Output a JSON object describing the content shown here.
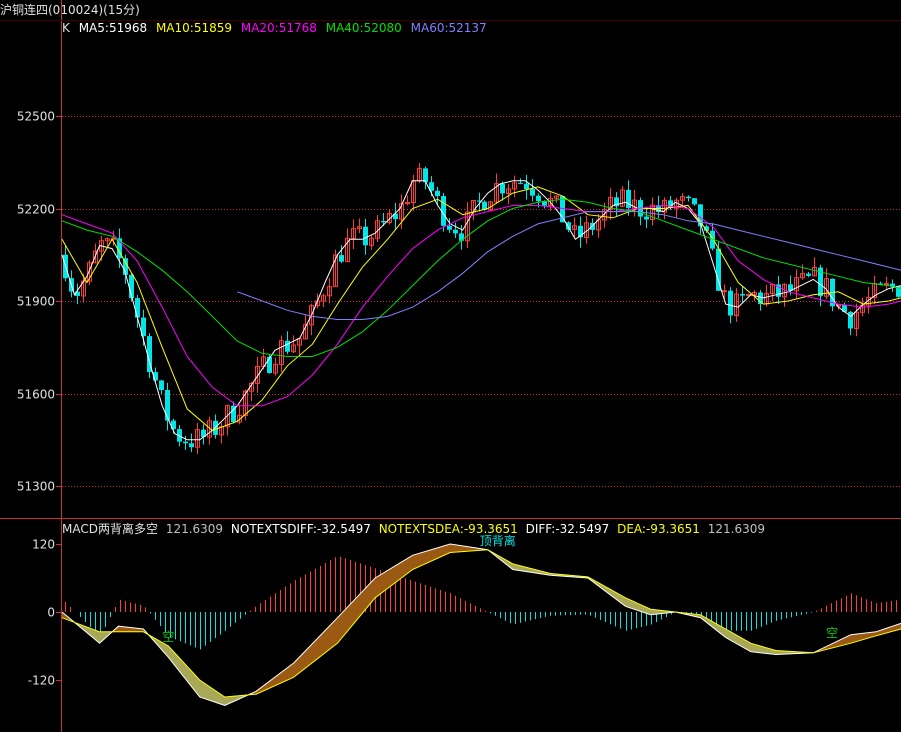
{
  "window": {
    "title": "沪铜连四(010024)(15分)"
  },
  "colors": {
    "up": "#ff3c3c",
    "down": "#00e5e5",
    "grid": "#c83232",
    "ma5": "#ffffff",
    "ma10": "#ffff00",
    "ma20": "#ff00ff",
    "ma40": "#00e000",
    "ma60": "#8080ff"
  },
  "legend": {
    "k": "K",
    "ma5": "MA5:51968",
    "ma10": "MA10:51859",
    "ma20": "MA20:51768",
    "ma40": "MA40:52080",
    "ma60": "MA60:52137"
  },
  "macd_legend": {
    "name": "MACD两背离多空",
    "v1": "121.6309",
    "notext_diff": "NOTEXTSDIFF:-32.5497",
    "notext_dea": "NOTEXTSDEA:-93.3651",
    "diff": "DIFF:-32.5497",
    "dea": "DEA:-93.3651",
    "v2": "121.6309"
  },
  "annotations": {
    "top_divergence": "顶背离",
    "kong1": "空",
    "kong2": "空"
  },
  "chart_data": [
    {
      "type": "candlestick",
      "title": "",
      "yticks": [
        "52500",
        "52200",
        "51900",
        "51600",
        "51300"
      ],
      "ylim": [
        51250,
        52650
      ],
      "series": [
        {
          "name": "MA5",
          "points": [
            [
              0,
              52050
            ],
            [
              10,
              51920
            ],
            [
              20,
              51980
            ],
            [
              30,
              52080
            ],
            [
              40,
              52070
            ],
            [
              50,
              52000
            ],
            [
              60,
              51850
            ],
            [
              70,
              51700
            ],
            [
              80,
              51560
            ],
            [
              90,
              51470
            ],
            [
              100,
              51450
            ],
            [
              110,
              51450
            ],
            [
              120,
              51480
            ],
            [
              130,
              51520
            ],
            [
              140,
              51560
            ],
            [
              150,
              51620
            ],
            [
              160,
              51680
            ],
            [
              170,
              51740
            ],
            [
              180,
              51760
            ],
            [
              190,
              51780
            ],
            [
              200,
              51860
            ],
            [
              210,
              51960
            ],
            [
              220,
              52050
            ],
            [
              230,
              52100
            ],
            [
              240,
              52100
            ],
            [
              250,
              52120
            ],
            [
              260,
              52160
            ],
            [
              270,
              52200
            ],
            [
              280,
              52290
            ],
            [
              290,
              52290
            ],
            [
              300,
              52210
            ],
            [
              310,
              52150
            ],
            [
              320,
              52130
            ],
            [
              330,
              52200
            ],
            [
              340,
              52250
            ],
            [
              350,
              52280
            ],
            [
              360,
              52290
            ],
            [
              370,
              52290
            ],
            [
              380,
              52260
            ],
            [
              390,
              52220
            ],
            [
              400,
              52170
            ],
            [
              410,
              52100
            ],
            [
              420,
              52130
            ],
            [
              430,
              52170
            ],
            [
              440,
              52210
            ],
            [
              450,
              52220
            ],
            [
              460,
              52200
            ],
            [
              470,
              52200
            ],
            [
              480,
              52190
            ],
            [
              490,
              52220
            ],
            [
              500,
              52200
            ],
            [
              510,
              52150
            ],
            [
              520,
              52020
            ],
            [
              530,
              51890
            ],
            [
              540,
              51880
            ],
            [
              550,
              51920
            ],
            [
              560,
              51910
            ],
            [
              570,
              51920
            ],
            [
              580,
              51930
            ],
            [
              590,
              51950
            ],
            [
              600,
              51970
            ],
            [
              610,
              51940
            ],
            [
              620,
              51880
            ],
            [
              630,
              51850
            ],
            [
              640,
              51890
            ],
            [
              650,
              51920
            ],
            [
              660,
              51940
            ],
            [
              670,
              51950
            ]
          ]
        },
        {
          "name": "MA10",
          "points": [
            [
              0,
              52100
            ],
            [
              20,
              51960
            ],
            [
              40,
              52100
            ],
            [
              60,
              51960
            ],
            [
              80,
              51750
            ],
            [
              100,
              51550
            ],
            [
              120,
              51480
            ],
            [
              140,
              51510
            ],
            [
              160,
              51580
            ],
            [
              180,
              51690
            ],
            [
              200,
              51760
            ],
            [
              220,
              51890
            ],
            [
              240,
              52010
            ],
            [
              260,
              52100
            ],
            [
              280,
              52200
            ],
            [
              300,
              52230
            ],
            [
              320,
              52180
            ],
            [
              340,
              52200
            ],
            [
              360,
              52250
            ],
            [
              380,
              52270
            ],
            [
              400,
              52240
            ],
            [
              420,
              52180
            ],
            [
              440,
              52170
            ],
            [
              460,
              52200
            ],
            [
              480,
              52200
            ],
            [
              500,
              52210
            ],
            [
              520,
              52100
            ],
            [
              540,
              51960
            ],
            [
              560,
              51890
            ],
            [
              580,
              51900
            ],
            [
              600,
              51920
            ],
            [
              620,
              51930
            ],
            [
              640,
              51890
            ],
            [
              660,
              51900
            ],
            [
              670,
              51910
            ]
          ]
        },
        {
          "name": "MA20",
          "points": [
            [
              0,
              52180
            ],
            [
              20,
              52150
            ],
            [
              40,
              52120
            ],
            [
              60,
              52030
            ],
            [
              80,
              51880
            ],
            [
              100,
              51720
            ],
            [
              120,
              51620
            ],
            [
              140,
              51560
            ],
            [
              160,
              51560
            ],
            [
              180,
              51590
            ],
            [
              200,
              51660
            ],
            [
              220,
              51760
            ],
            [
              240,
              51880
            ],
            [
              260,
              51980
            ],
            [
              280,
              52070
            ],
            [
              300,
              52130
            ],
            [
              320,
              52170
            ],
            [
              340,
              52190
            ],
            [
              360,
              52210
            ],
            [
              380,
              52210
            ],
            [
              400,
              52200
            ],
            [
              420,
              52190
            ],
            [
              440,
              52190
            ],
            [
              460,
              52200
            ],
            [
              480,
              52210
            ],
            [
              500,
              52200
            ],
            [
              520,
              52140
            ],
            [
              540,
              52030
            ],
            [
              560,
              51970
            ],
            [
              580,
              51930
            ],
            [
              600,
              51910
            ],
            [
              620,
              51890
            ],
            [
              640,
              51880
            ],
            [
              660,
              51890
            ],
            [
              670,
              51900
            ]
          ]
        },
        {
          "name": "MA40",
          "points": [
            [
              0,
              52160
            ],
            [
              20,
              52130
            ],
            [
              40,
              52110
            ],
            [
              60,
              52060
            ],
            [
              80,
              52000
            ],
            [
              100,
              51930
            ],
            [
              120,
              51850
            ],
            [
              140,
              51770
            ],
            [
              160,
              51730
            ],
            [
              180,
              51720
            ],
            [
              200,
              51720
            ],
            [
              220,
              51750
            ],
            [
              240,
              51800
            ],
            [
              260,
              51870
            ],
            [
              280,
              51950
            ],
            [
              300,
              52030
            ],
            [
              320,
              52100
            ],
            [
              340,
              52160
            ],
            [
              360,
              52200
            ],
            [
              380,
              52220
            ],
            [
              400,
              52230
            ],
            [
              420,
              52220
            ],
            [
              440,
              52200
            ],
            [
              460,
              52190
            ],
            [
              480,
              52160
            ],
            [
              500,
              52130
            ],
            [
              520,
              52100
            ],
            [
              540,
              52070
            ],
            [
              560,
              52040
            ],
            [
              580,
              52020
            ],
            [
              600,
              52000
            ],
            [
              620,
              51980
            ],
            [
              640,
              51960
            ],
            [
              660,
              51950
            ],
            [
              670,
              51940
            ]
          ]
        },
        {
          "name": "MA60",
          "points": [
            [
              140,
              51930
            ],
            [
              160,
              51900
            ],
            [
              180,
              51870
            ],
            [
              200,
              51850
            ],
            [
              220,
              51840
            ],
            [
              240,
              51840
            ],
            [
              260,
              51850
            ],
            [
              280,
              51880
            ],
            [
              300,
              51930
            ],
            [
              320,
              51990
            ],
            [
              340,
              52060
            ],
            [
              360,
              52110
            ],
            [
              380,
              52150
            ],
            [
              400,
              52170
            ],
            [
              420,
              52190
            ],
            [
              440,
              52190
            ],
            [
              460,
              52190
            ],
            [
              480,
              52180
            ],
            [
              500,
              52160
            ],
            [
              520,
              52150
            ],
            [
              540,
              52130
            ],
            [
              560,
              52110
            ],
            [
              580,
              52090
            ],
            [
              600,
              52070
            ],
            [
              620,
              52050
            ],
            [
              640,
              52030
            ],
            [
              660,
              52010
            ],
            [
              670,
              52000
            ]
          ]
        }
      ]
    },
    {
      "type": "bar",
      "title": "",
      "yticks": [
        "120",
        "0",
        "-120"
      ],
      "ylim": [
        -205,
        140
      ]
    }
  ]
}
